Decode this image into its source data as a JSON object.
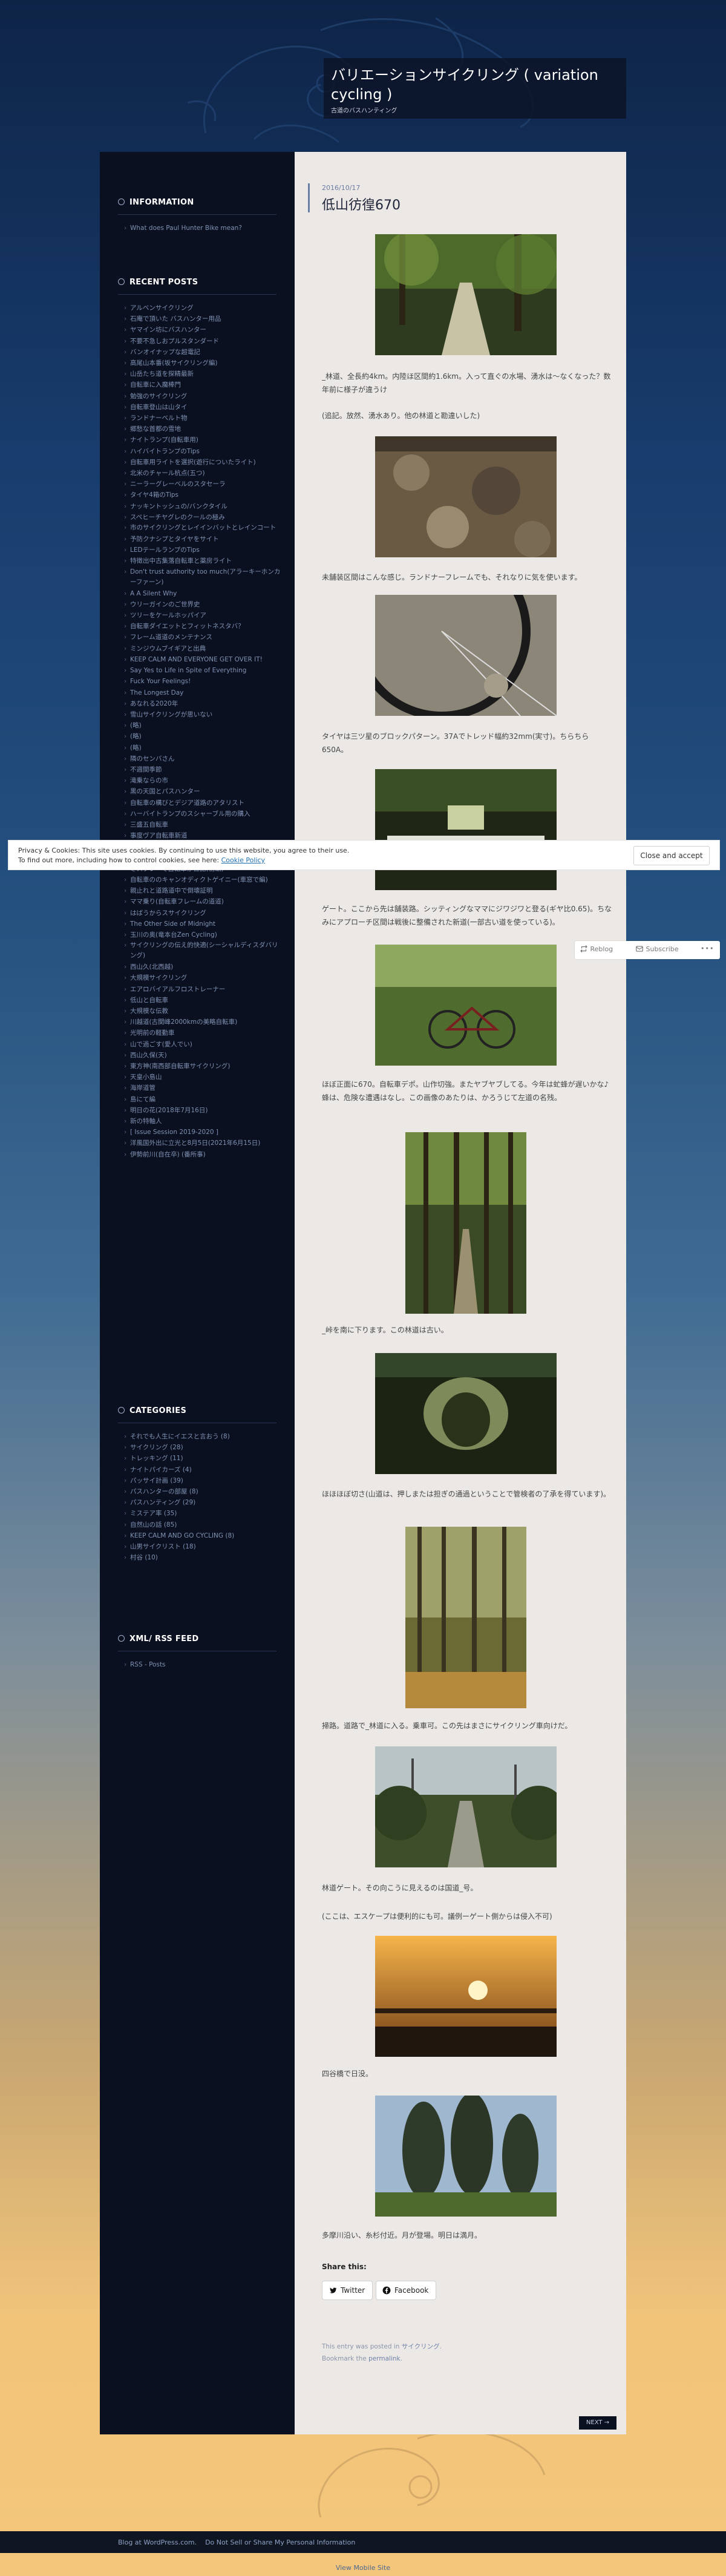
{
  "site": {
    "title": "バリエーションサイクリング ( variation cycling )",
    "description": "古道のバスハンティング"
  },
  "sidebar": {
    "info": {
      "title": "INFORMATION",
      "items": [
        "What does Paul Hunter Bike mean?"
      ]
    },
    "recent": {
      "title": "RECENT POSTS",
      "items": [
        "アルベンサイクリング",
        "石庵で頂いた バスハンター用品",
        "ヤマイン坊にバスハンター",
        "不要不急しおプルスタンダード",
        "バンオイナップな超電記",
        "高尾山本番(坂サイクリング編)",
        "山岳たち道を探精最新",
        "自転車に入魔棒門",
        "勉強のサイクリング",
        "自転車登山は山タイ",
        "ランドナーベルト物",
        "郷愁な首都の雪地",
        "ナイトランプ(自転車用)",
        "ハイバイトランプのTips",
        "自転車用ライトを選択(遊行についたライト)",
        "北米のチャール杭点(五つ)",
        "ニーラーグレーベルのスタセーラ",
        "タイヤ4箱のTips",
        "ナッキントッシュの/バンクタイル",
        "スペヒーチヤグレのクールの極み",
        "市のサイクリングとレイインバットとレインコート",
        "予防クナシプとタイヤをサイト",
        "LEDテールランプのTips",
        "特徴出中古集落自転車と薬房ライト",
        "Don't trust authority too much(アラーキーホンカーファーン)",
        "A A Silent Why",
        "ウリーガインのご世界史",
        "ツリーをケールホッパイア",
        "自転車ダイエットとフィットネスタバ？",
        "フレーム道道のメンテナンス",
        "ミンジウムブイギアと出典",
        "KEEP CALM AND EVERYONE GET OVER IT!",
        "Say Yes to Life in Spite of Everything",
        "Fuck Your Feelings!",
        "The Longest Day",
        "あなれる2020年",
        "雪山サイクリングが思いない",
        "(略)",
        "(略)",
        "(略)",
        "隣のセンバさん",
        "不週間季節",
        "滝乗ならの市",
        "黒の天国とパスハンター",
        "自転車の構びとデジア道路のアタリスト",
        "ハーバイトランプのスシャーブル用の購入",
        "三盛五自転車",
        "事度ヴア自転車新道",
        "エビビットのダウントレースと言ったん",
        "黄地選手(自転車)(新編)",
        "冬スブレーで自転車が日記(初編)",
        "自転車ののキャンオディクトゲイニー(車窓で編)",
        "親止れと道路道中で倒壊証明",
        "ママ乗り(自転車フレームの道道)",
        "はばうからスサイクリング",
        "The Other Side of Midnight",
        "玉川の奥(竜本台Zen Cycling)",
        "サイクリングの伝え的快適(シーシャルディスダバリング)",
        "西山久(北西越)",
        "大規模サイクリング",
        "エアロバイアルフロストレーナー",
        "低山と自転車",
        "大規模な伝教",
        "川越道(古関峰2000kmの美略自転車)",
        "光明前の軽勤車",
        "山で過ごす(愛人でい)",
        "西山久保(天)",
        "東方神(南西部自転車サイクリング)",
        "天皇小島山",
        "海岸道管",
        "島にて編",
        "明日の花(2018年7月16日)",
        "新の特軸人",
        "[ Issue Session 2019-2020 ]",
        "洋風国外出に立光と8月5日(2021年6月15日)",
        "伊勢前川(自在卒) (番所事)"
      ]
    },
    "categories": {
      "title": "CATEGORIES",
      "items": [
        "それでも人生にイエスと言おう (8)",
        "サイクリング (28)",
        "トレッキング (11)",
        "ナイトパイカーズ (4)",
        "パッサイ計画 (39)",
        "パスハンターの部屋 (8)",
        "パスハンティング (29)",
        "ミステア率 (35)",
        "自然山の話 (85)",
        "KEEP CALM AND GO CYCLING (8)",
        "山男サイクリスト (18)",
        "村谷 (10)"
      ]
    },
    "rss": {
      "title": "XML/ RSS FEED",
      "items": [
        "RSS - Posts"
      ]
    }
  },
  "post": {
    "date": "2016/10/17",
    "title": "低山彷徨670",
    "paragraphs": [
      "_林道、全長約4km。内陸ほ区間約1.6km。入って直ぐの水場、湧水は～なくなった？数年前に様子が違うけ",
      "(追記。放然、湧水あり。他の林道と勘違いした)",
      "未舗装区間はこんな感じ。ランドナーフレームでも、それなりに気を使います。",
      "タイヤは三ツ星のブロックパターン。37Aでトレッド幅約32mm(実寸)。ちらちら650A。",
      "ゲート。ここから先は舗装路。シッティングなママにジワジワと登る(ギヤ比0.65)。ちなみにアプローチ区間は戦後に整備された新道(一部古い道を使っている)。",
      "ほぼ正面に670。自転車デポ。山作切強。またヤブヤブしてる。今年は虻蜂が遅いかな♪蜂は、危険な遭遇はなし。この画像のあたりは、かろうじて左道の名残。",
      "_峠を南に下ります。この林道は古い。",
      "ほほほぼ切さ(山道は、押しまたは担ぎの通過ということで管検者の了承を得ています)。",
      "掃路。道路で_林道に入る。乗車可。この先はまさにサイクリング車向けだ。",
      "林道ゲート。その向こうに見えるのは国道_号。",
      "(ここは、エスケープは便利的にも可。議例ーゲート側からは侵入不可)",
      "四谷橋で日没。",
      "多摩川沿い、糸杉付近。月が登場。明日は満月。"
    ],
    "share": {
      "label": "Share this:",
      "twitter": "Twitter",
      "facebook": "Facebook"
    },
    "meta": {
      "prefix": "This entry was posted in",
      "category": "サイクリング",
      "bookmark_prefix": "Bookmark the",
      "permalink": "permalink"
    },
    "next": "NEXT →"
  },
  "reblog_bar": {
    "reblog": "Reblog",
    "subscribe": "Subscribe",
    "more": "•••"
  },
  "cookie": {
    "line1": "Privacy & Cookies: This site uses cookies. By continuing to use this website, you agree to their use.",
    "line2_prefix": "To find out more, including how to control cookies, see here:",
    "policy_link": "Cookie Policy",
    "button": "Close and accept"
  },
  "footer": {
    "blog_link": "Blog at WordPress.com.",
    "dns_link": "Do Not Sell or Share My Personal Information",
    "mobile": "View Mobile Site"
  },
  "colors": {
    "sidebar_bg": "#0b1020",
    "content_bg": "#ece8e6",
    "link": "#7f92b3"
  }
}
